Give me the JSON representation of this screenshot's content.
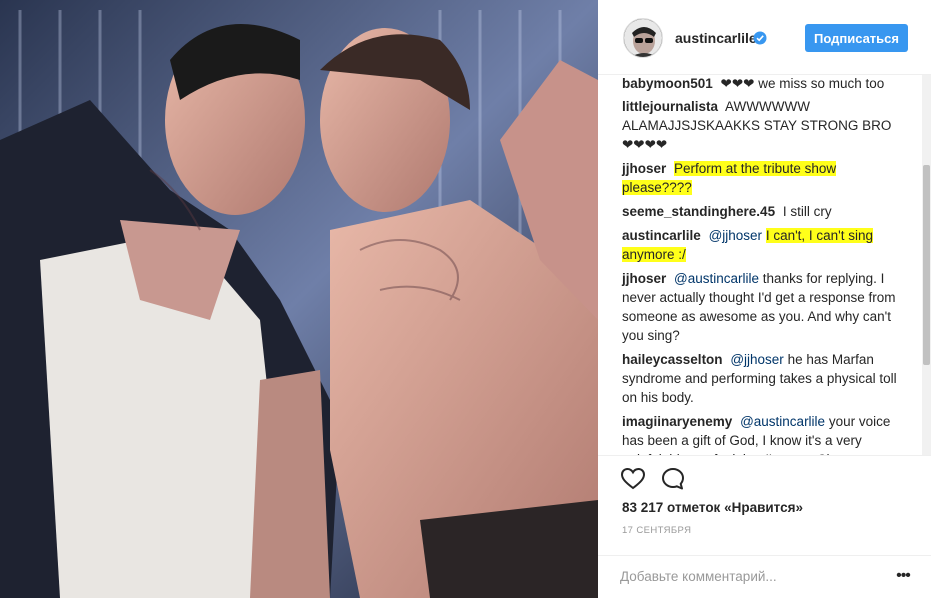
{
  "header": {
    "username": "austincarlile",
    "follow_label": "Подписаться"
  },
  "comments": [
    {
      "user": "babymoon501",
      "text": "❤❤❤ we miss so much too"
    },
    {
      "user": "littlejournalista",
      "text": "AWWWWWW ALAMAJJSJSKAAKKS STAY STRONG BRO ❤❤❤❤"
    },
    {
      "user": "jjhoser",
      "text": "Perform at the tribute show please????"
    },
    {
      "user": "seeme_standinghere.45",
      "text": "I still cry"
    },
    {
      "user": "austincarlile",
      "mention": "@jjhoser",
      "text": "I can't, I can't sing anymore :/"
    },
    {
      "user": "jjhoser",
      "mention": "@austincarlile",
      "text": "thanks for replying. I never actually thought I'd get a response from someone as awesome as you. And why can't you sing?"
    },
    {
      "user": "haileycasselton",
      "mention": "@jjhoser",
      "text": "he has Marfan syndrome and performing takes a physical toll on his body."
    },
    {
      "user": "imagiinaryenemy",
      "mention": "@austincarlile",
      "text": "your voice has been a gift of God, I know it's a very painful thing to feel. but I'm sure Chester"
    }
  ],
  "actions": {
    "likes": "83 217 отметок «Нравится»",
    "date": "17 СЕНТЯБРЯ",
    "comment_placeholder": "Добавьте комментарий...",
    "more_label": "•••"
  },
  "icons": {
    "like": "heart-outline-icon",
    "comment": "speech-bubble-icon",
    "verified": "verified-badge-icon",
    "more": "more-dots-icon"
  },
  "colors": {
    "accent": "#3897f0",
    "highlight": "#ffff1a",
    "mention": "#003569"
  }
}
